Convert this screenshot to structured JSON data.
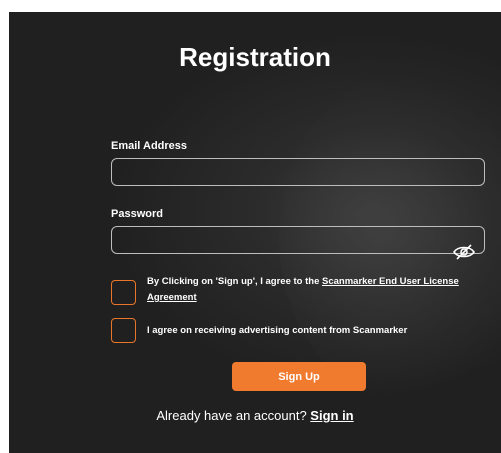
{
  "form": {
    "title": "Registration",
    "email_label": "Email Address",
    "email_value": "",
    "password_label": "Password",
    "password_value": "",
    "password_toggle_icon": "eye-slash-icon"
  },
  "consents": {
    "license_prefix": "By Clicking on 'Sign up', I agree to the ",
    "license_link": "Scanmarker End User License Agreement",
    "advertising": "I agree on receiving advertising content from Scanmarker"
  },
  "actions": {
    "signup_label": "Sign Up",
    "signin_prompt": "Already have an account? ",
    "signin_link": "Sign in"
  },
  "colors": {
    "accent": "#f07a2e",
    "background": "#262626",
    "text": "#ffffff"
  }
}
